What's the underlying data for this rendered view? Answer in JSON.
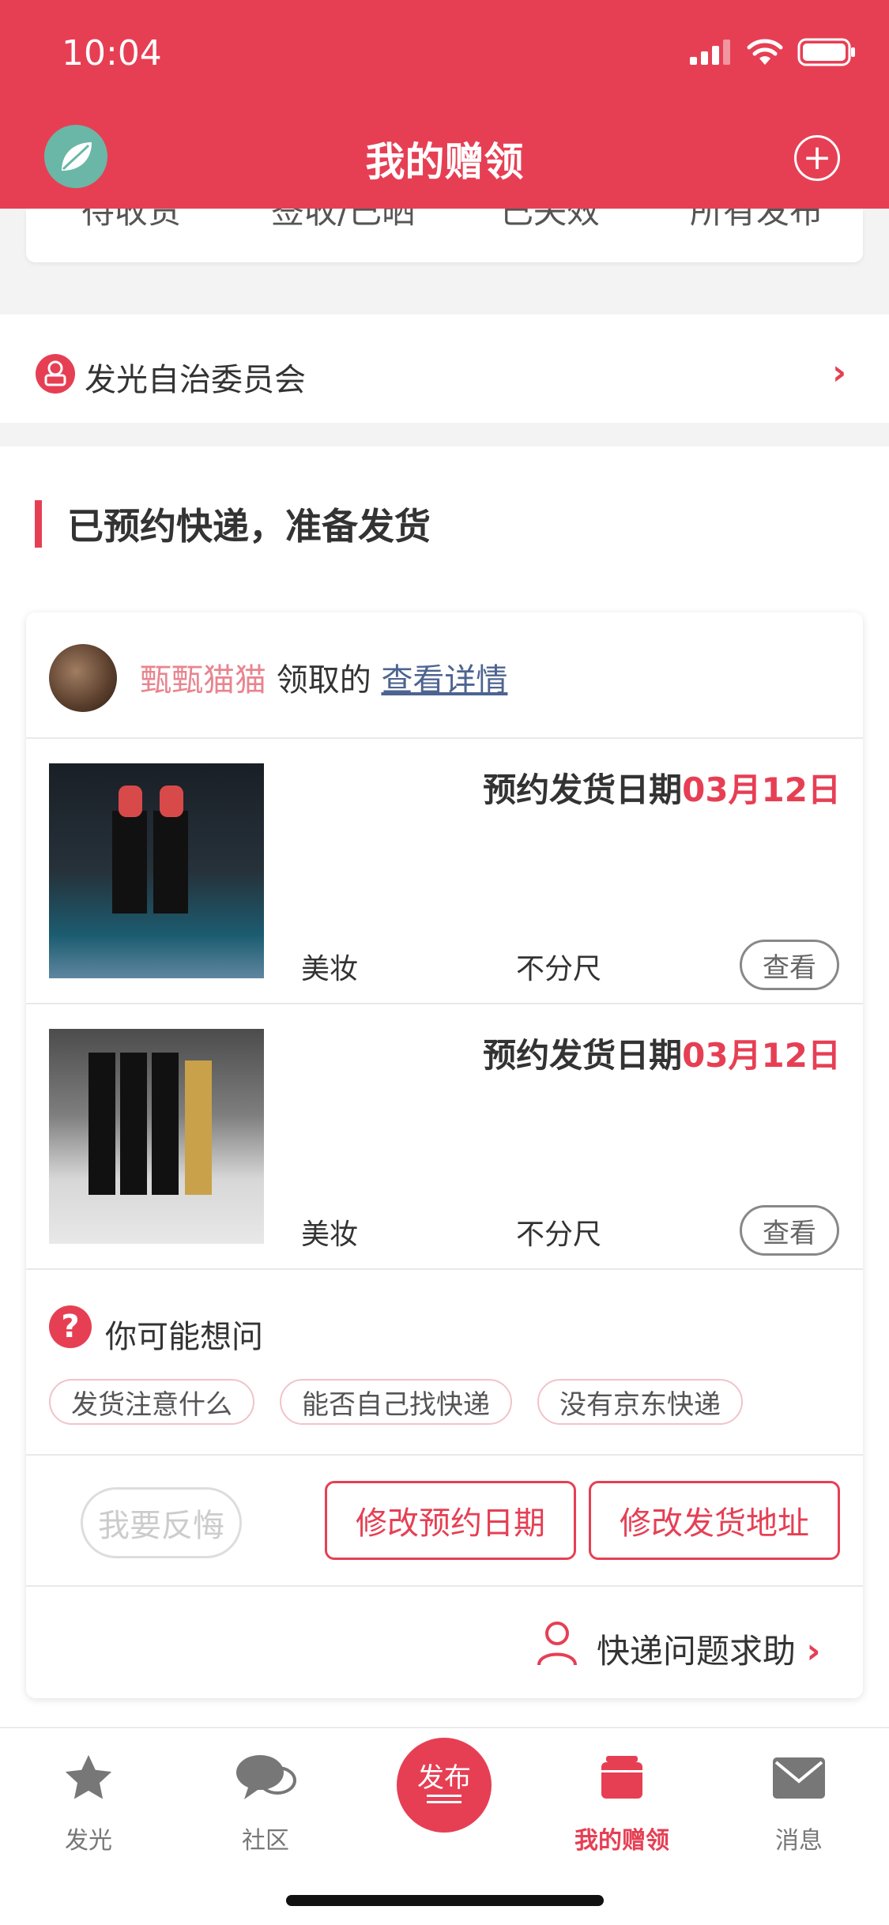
{
  "status": {
    "time": "10:04"
  },
  "header": {
    "title": "我的赠领"
  },
  "top_tabs": [
    "待收货",
    "签收/已晒",
    "已失效",
    "所有发布"
  ],
  "committee": {
    "label": "发光自治委员会"
  },
  "section": {
    "title": "已预约快递，准备发货"
  },
  "order": {
    "user_name": "甄甄猫猫",
    "claimed_text": "领取的",
    "detail_link": "查看详情",
    "items": [
      {
        "ship_label": "预约发货日期",
        "ship_date": "03月12日",
        "category": "美妆",
        "size": "不分尺",
        "view_label": "查看"
      },
      {
        "ship_label": "预约发货日期",
        "ship_date": "03月12日",
        "category": "美妆",
        "size": "不分尺",
        "view_label": "查看"
      }
    ],
    "faq_title": "你可能想问",
    "faq_chips": [
      "发货注意什么",
      "能否自己找快递",
      "没有京东快递"
    ],
    "regret_label": "我要反悔",
    "change_date_label": "修改预约日期",
    "change_address_label": "修改发货地址",
    "help_label": "快递问题求助"
  },
  "tabbar": {
    "items": [
      {
        "label": "发光",
        "icon": "star-icon"
      },
      {
        "label": "社区",
        "icon": "chat-icon"
      },
      {
        "label": "发布",
        "icon": "publish-icon"
      },
      {
        "label": "我的赠领",
        "icon": "cards-icon",
        "active": true
      },
      {
        "label": "消息",
        "icon": "mail-icon"
      }
    ]
  },
  "colors": {
    "brand": "#e63f54",
    "link": "#4d6491",
    "username": "#e8858f"
  }
}
